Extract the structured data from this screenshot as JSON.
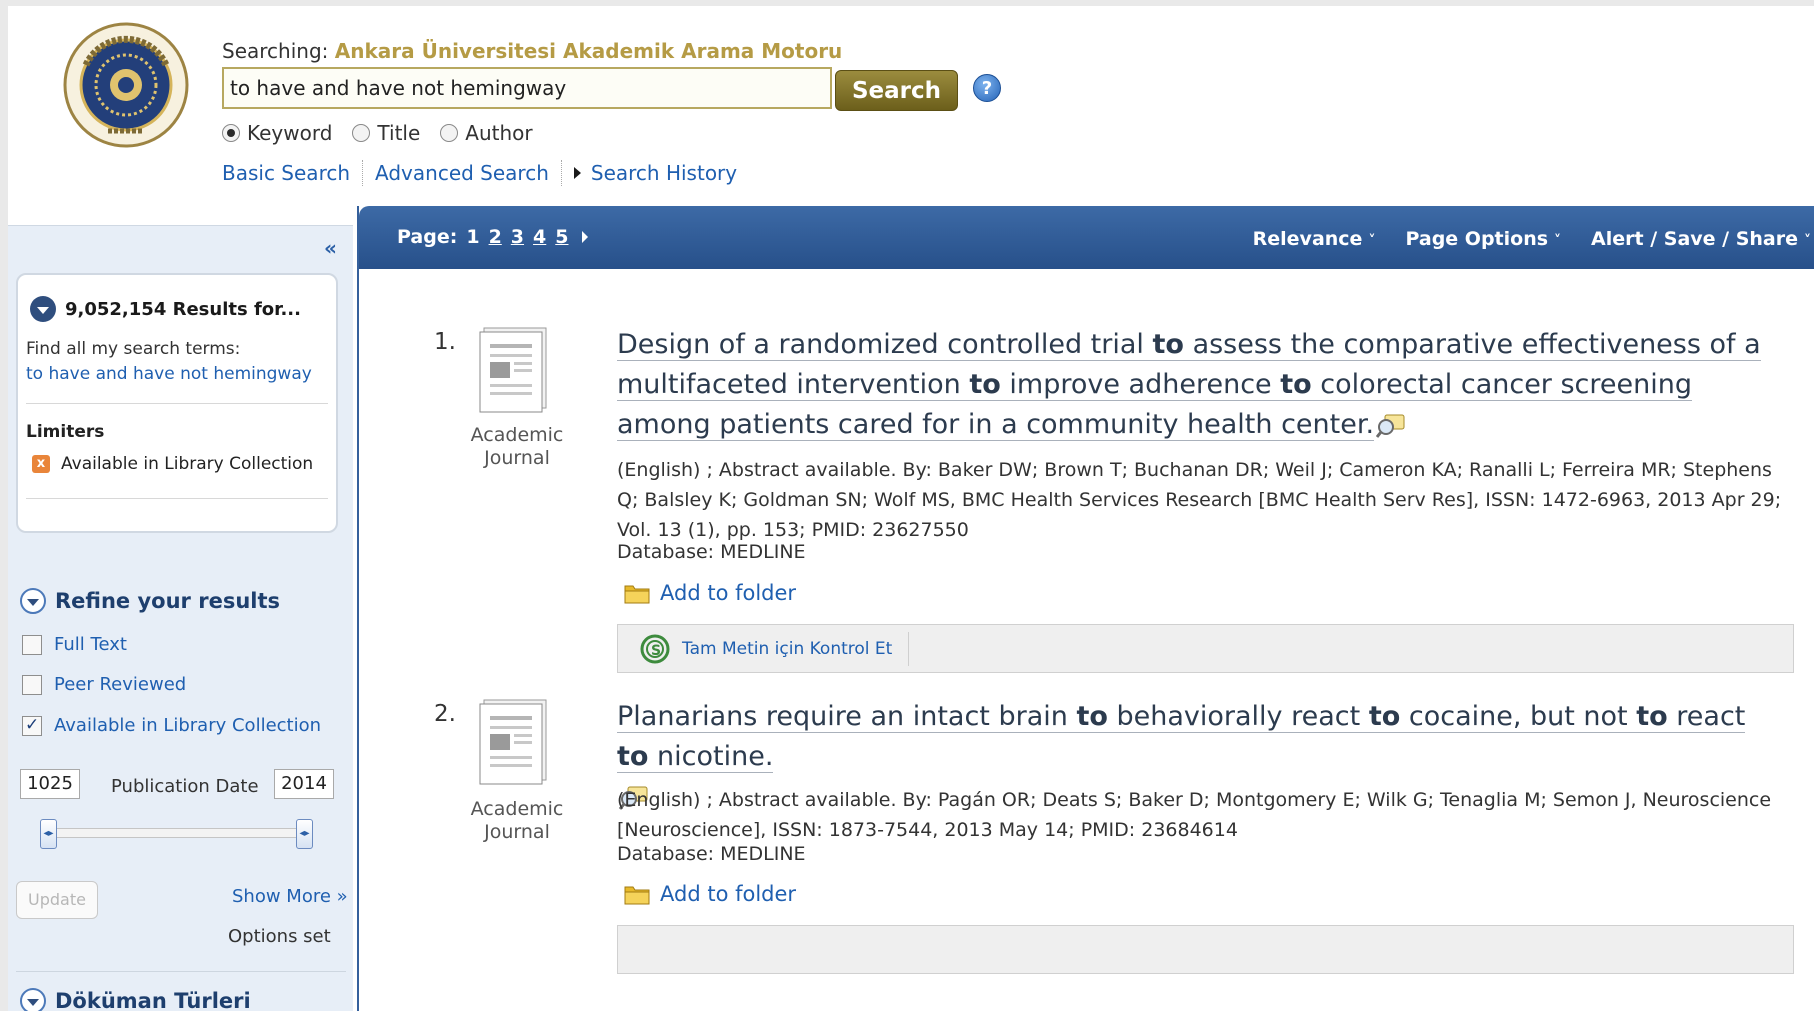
{
  "header": {
    "searching_label": "Searching:",
    "database_name": "Ankara Üniversitesi Akademik Arama Motoru",
    "search_query": "to have and have not hemingway",
    "search_button": "Search",
    "help_label": "?",
    "search_options": [
      {
        "label": "Keyword",
        "selected": true
      },
      {
        "label": "Title",
        "selected": false
      },
      {
        "label": "Author",
        "selected": false
      }
    ],
    "nav_links": [
      "Basic Search",
      "Advanced Search",
      "Search History"
    ]
  },
  "sidebar": {
    "collapse_label": "«",
    "results_heading": "9,052,154 Results for...",
    "find_all_label": "Find all my search terms:",
    "search_terms": "to have and have not hemingway",
    "limiters_heading": "Limiters",
    "limiter_item": "Available in Library Collection",
    "limiter_remove": "x",
    "refine_heading": "Refine your results",
    "filters": [
      {
        "label": "Full Text",
        "checked": false
      },
      {
        "label": "Peer Reviewed",
        "checked": false
      },
      {
        "label": "Available in Library Collection",
        "checked": true
      }
    ],
    "pub_date_label": "Publication Date",
    "year_from": "1025",
    "year_to": "2014",
    "update_button": "Update",
    "show_more": "Show More »",
    "options_set": "Options set",
    "doc_types_heading": "Döküman Türleri"
  },
  "toolbar": {
    "page_label": "Page:",
    "pages": [
      "1",
      "2",
      "3",
      "4",
      "5"
    ],
    "current_page": "1",
    "sort": "Relevance",
    "page_options": "Page Options",
    "alert_save_share": "Alert / Save / Share"
  },
  "results": [
    {
      "number": "1.",
      "type_line1": "Academic",
      "type_line2": "Journal",
      "title_parts": [
        "Design of a randomized controlled trial ",
        "to",
        " assess the comparative effectiveness of a multifaceted intervention ",
        "to",
        " improve adherence ",
        "to",
        " colorectal cancer screening among patients cared for in a community health center."
      ],
      "meta": "(English) ; Abstract available. By: Baker DW; Brown T; Buchanan DR; Weil J; Cameron KA; Ranalli L; Ferreira MR; Stephens Q; Balsley K; Goldman SN; Wolf MS, BMC Health Services Research [BMC Health Serv Res], ISSN: 1472-6963, 2013 Apr 29; Vol. 13 (1), pp. 153; PMID: 23627550",
      "database": "Database: MEDLINE",
      "add_to_folder": "Add to folder",
      "fulltext_link": "Tam Metin için Kontrol Et"
    },
    {
      "number": "2.",
      "type_line1": "Academic",
      "type_line2": "Journal",
      "title_parts": [
        "Planarians require an intact brain ",
        "to",
        " behaviorally react ",
        "to",
        " cocaine, but not ",
        "to",
        " react ",
        "to",
        " nicotine."
      ],
      "meta": "(English) ; Abstract available. By: Pagán OR; Deats S; Baker D; Montgomery E; Wilk G; Tenaglia M; Semon J, Neuroscience [Neuroscience], ISSN: 1873-7544, 2013 May 14; PMID: 23684614",
      "database": "Database: MEDLINE",
      "add_to_folder": "Add to folder"
    }
  ],
  "colors": {
    "link": "#1f5fb0",
    "toolbar": "#2f5b96",
    "search_button": "#7d6f28",
    "database_name": "#b59b45"
  }
}
